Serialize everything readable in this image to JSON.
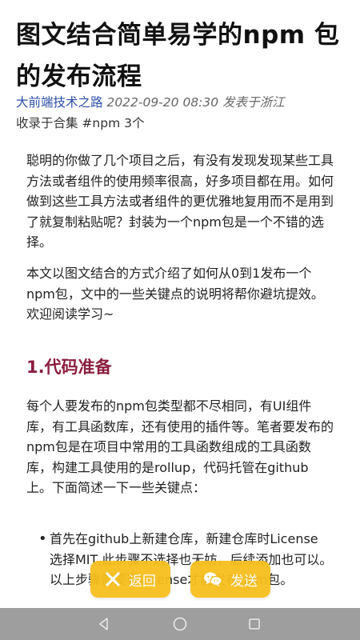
{
  "article": {
    "title": "图文结合简单易学的npm 包的发布流程",
    "account": "大前端技术之路",
    "datetime": "2022-09-20 08:30",
    "location": "发表于浙江",
    "collection": "收录于合集 #npm 3个",
    "paragraph1": "聪明的你做了几个项目之后，有没有发现发现某些工具方法或者组件的使用频率很高，好多项目都在用。如何做到这些工具方法或者组件的更优雅地复用而不是用到了就复制粘贴呢？封装为一个npm包是一个不错的选择。",
    "paragraph2": "本文以图文结合的方式介绍了如何从0到1发布一个npm包，文中的一些关键点的说明将帮你避坑提效。欢迎阅读学习~",
    "section1_heading": "1.代码准备",
    "paragraph3": "每个人要发布的npm包类型都不尽相同，有UI组件库，有工具函数库，还有使用的插件等。笔者要发布的npm包是在项目中常用的工具函数组成的工具函数库，构建工具使用的是rollup，代码托管在github上。下面简述一下一些关键点：",
    "bullet1": "首先在github上新建仓库，新建仓库时License 选择MIT,此步骤不选择也无妨，后续添加也可以。以上步骤需要有License才能发布npm包。"
  },
  "floating_actions": {
    "back_label": "返回",
    "send_label": "发送",
    "back_icon": "close-x-icon",
    "send_icon": "wechat-icon"
  },
  "system_nav": {
    "back_icon": "nav-back-triangle-icon",
    "home_icon": "nav-home-circle-icon",
    "recent_icon": "nav-recent-square-icon"
  },
  "colors": {
    "link": "#2b4ea8",
    "heading": "#8b1e3f",
    "fab": "#f6bf1c",
    "navbar": "#9e9e9e"
  }
}
